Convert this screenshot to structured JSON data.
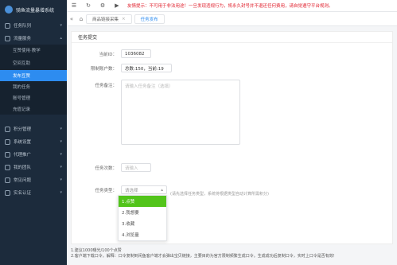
{
  "app": {
    "title": "骑鱼流量暴增系统"
  },
  "sidebar": {
    "items": [
      {
        "label": "任务队列",
        "icon": "list-icon"
      },
      {
        "label": "流量服务",
        "icon": "traffic-icon"
      }
    ],
    "subitems": [
      {
        "label": "互赞使用·教学"
      },
      {
        "label": "空间互助"
      },
      {
        "label": "发布互赞",
        "active": true
      },
      {
        "label": "我的任务"
      },
      {
        "label": "账号管理"
      },
      {
        "label": "充值记录"
      }
    ],
    "lower_items": [
      {
        "label": "积分管理",
        "icon": "points-icon"
      },
      {
        "label": "系统设置",
        "icon": "settings-icon"
      },
      {
        "label": "代理推广",
        "icon": "share-icon"
      },
      {
        "label": "我的团队",
        "icon": "team-icon"
      },
      {
        "label": "常见问题",
        "icon": "help-icon"
      },
      {
        "label": "实名认证",
        "icon": "id-icon"
      }
    ]
  },
  "topbar": {
    "notice": "友情提示：不可用于非法用途！一旦发现违规行为，将永久封号并不退还任何费用，请自觉遵守平台规则。"
  },
  "tabs": [
    {
      "label": "商品链接采集",
      "active": false
    },
    {
      "label": "任务发布",
      "active": true
    }
  ],
  "form": {
    "title": "任务提交",
    "id_label": "当前ID：",
    "id_value": "1036082",
    "limit_label": "限制账户数：",
    "limit_value": "总数:150，当前:19",
    "remark_label": "任务备注：",
    "remark_placeholder": "请输入任务备注（选填）",
    "count_label": "任务次数：",
    "count_value": "请输入",
    "type_label": "任务类型：",
    "type_placeholder": "请选择",
    "type_hint": "(请先选择任务类型，系统将根据类型自动计算所需积分)",
    "type_options": [
      "1.点赞",
      "2.我想要",
      "3.收藏",
      "4.浏览量"
    ],
    "type_selected_index": 0
  },
  "footer": {
    "line1": "1.建议1000曝光/100个点赞",
    "line2": "2.客户端下载口令。解释：口令复制到闲鱼客户端才会弹出宝贝链接，主要目的为官方限制频繁生成口令。生成成功后复制口令，实时上口令是否有效!"
  }
}
